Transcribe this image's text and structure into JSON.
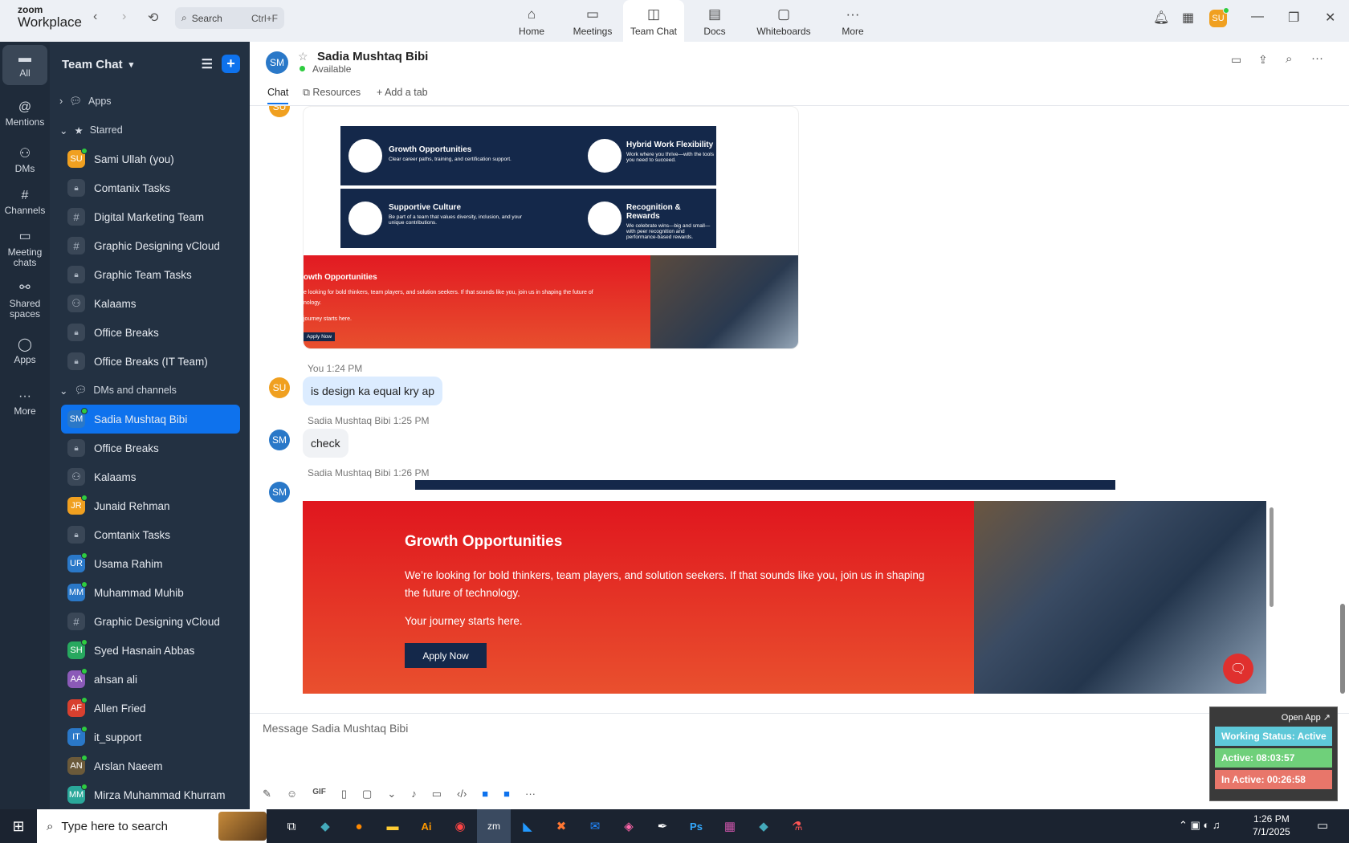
{
  "app": {
    "brand_top": "zoom",
    "brand_bottom": "Workplace",
    "search_label": "Search",
    "search_shortcut": "Ctrl+F"
  },
  "nav": [
    {
      "label": "Home",
      "icon": "home-icon"
    },
    {
      "label": "Meetings",
      "icon": "camera-icon"
    },
    {
      "label": "Team Chat",
      "icon": "chat-icon"
    },
    {
      "label": "Docs",
      "icon": "doc-icon"
    },
    {
      "label": "Whiteboards",
      "icon": "whiteboard-icon"
    },
    {
      "label": "More",
      "icon": "more-icon"
    }
  ],
  "user": {
    "initials": "SU"
  },
  "rail": [
    {
      "label": "All",
      "icon": "chat-icon"
    },
    {
      "label": "Mentions",
      "icon": "at-icon"
    },
    {
      "label": "DMs",
      "icon": "people-icon"
    },
    {
      "label": "Channels",
      "icon": "hash-icon"
    },
    {
      "label": "Meeting chats",
      "icon": "calendar-icon"
    },
    {
      "label": "Shared spaces",
      "icon": "share-icon"
    },
    {
      "label": "Apps",
      "icon": "apps-icon"
    },
    {
      "label": "More",
      "icon": "more-icon"
    }
  ],
  "sidebar": {
    "title": "Team Chat",
    "apps": "Apps",
    "starred": "Starred",
    "dms_section": "DMs and channels",
    "starred_items": [
      {
        "label": "Sami Ullah (you)",
        "type": "avatar",
        "initials": "SU",
        "color": "#f0a020"
      },
      {
        "label": "Comtanix Tasks",
        "type": "lock"
      },
      {
        "label": "Digital Marketing Team",
        "type": "hash"
      },
      {
        "label": "Graphic Designing vCloud",
        "type": "hash"
      },
      {
        "label": "Graphic Team Tasks",
        "type": "lock"
      },
      {
        "label": "Kalaams",
        "type": "group"
      },
      {
        "label": "Office Breaks",
        "type": "lock"
      },
      {
        "label": "Office Breaks (IT Team)",
        "type": "lock"
      }
    ],
    "dm_items": [
      {
        "label": "Sadia Mushtaq Bibi",
        "type": "avatar",
        "initials": "SM",
        "color": "#2a78c8",
        "selected": true
      },
      {
        "label": "Office Breaks",
        "type": "lock"
      },
      {
        "label": "Kalaams",
        "type": "group"
      },
      {
        "label": "Junaid Rehman",
        "type": "avatar",
        "initials": "JR",
        "color": "#f0a020"
      },
      {
        "label": "Comtanix Tasks",
        "type": "lock"
      },
      {
        "label": "Usama Rahim",
        "type": "avatar",
        "initials": "UR",
        "color": "#2a78c8"
      },
      {
        "label": "Muhammad Muhib",
        "type": "avatar",
        "initials": "MM",
        "color": "#2a78c8"
      },
      {
        "label": "Graphic Designing vCloud",
        "type": "hash"
      },
      {
        "label": "Syed Hasnain Abbas",
        "type": "avatar",
        "initials": "SH",
        "color": "#27a85f"
      },
      {
        "label": "ahsan ali",
        "type": "avatar",
        "initials": "AA",
        "color": "#8b5ab8"
      },
      {
        "label": "Allen Fried",
        "type": "avatar",
        "initials": "AF",
        "color": "#d8402f"
      },
      {
        "label": "it_support",
        "type": "avatar",
        "initials": "IT",
        "color": "#2a78c8"
      },
      {
        "label": "Arslan Naeem",
        "type": "avatar",
        "initials": "AN",
        "color": "#6b5a3a"
      },
      {
        "label": "Mirza Muhammad Khurram",
        "type": "avatar",
        "initials": "MM",
        "color": "#2aa89a"
      }
    ]
  },
  "chat": {
    "name": "Sadia Mushtaq Bibi",
    "initials": "SM",
    "status": "Available",
    "tabs": [
      "Chat",
      "Resources",
      "Add a tab"
    ],
    "card_top": [
      {
        "title": "Growth Opportunities",
        "text": "Clear career paths, training, and certification support."
      },
      {
        "title": "Hybrid Work Flexibility",
        "text": "Work where you thrive—with the tools you need to succeed."
      },
      {
        "title": "Supportive Culture",
        "text": "Be part of a team that values diversity, inclusion, and your unique contributions."
      },
      {
        "title": "Recognition & Rewards",
        "text": "We celebrate wins—big and small—with peer recognition and performance-based rewards."
      }
    ],
    "thumb": {
      "title": "owth Opportunities",
      "line": "e looking for bold thinkers, team players, and solution seekers. If that sounds like you, join us in shaping the future of",
      "line2": "nology.",
      "line3": "journey starts here.",
      "btn": "Apply Now"
    },
    "messages": [
      {
        "sender": "You",
        "time": "1:24 PM",
        "initials": "SU",
        "text": "is design ka equal kry ap"
      },
      {
        "sender": "Sadia Mushtaq Bibi",
        "time": "1:25 PM",
        "initials": "SM",
        "text": "check"
      },
      {
        "sender": "Sadia Mushtaq Bibi",
        "time": "1:26 PM",
        "initials": "SM"
      }
    ],
    "banner": {
      "title": "Growth Opportunities",
      "text": "We’re looking for bold thinkers, team players, and solution seekers. If that sounds like you, join us in shaping the future of technology.",
      "sub": "Your journey starts here.",
      "btn": "Apply Now"
    },
    "composer_placeholder": "Message Sadia Mushtaq Bibi"
  },
  "widget": {
    "open": "Open App ↗",
    "status": "Working Status: Active",
    "active": "Active: 08:03:57",
    "inactive": "In Active: 00:26:58",
    "colors": {
      "status": "#5ec8d8",
      "active": "#6fd07a",
      "inactive": "#e8766a"
    }
  },
  "taskbar": {
    "search": "Type here to search",
    "time": "1:26 PM",
    "date": "7/1/2025"
  }
}
